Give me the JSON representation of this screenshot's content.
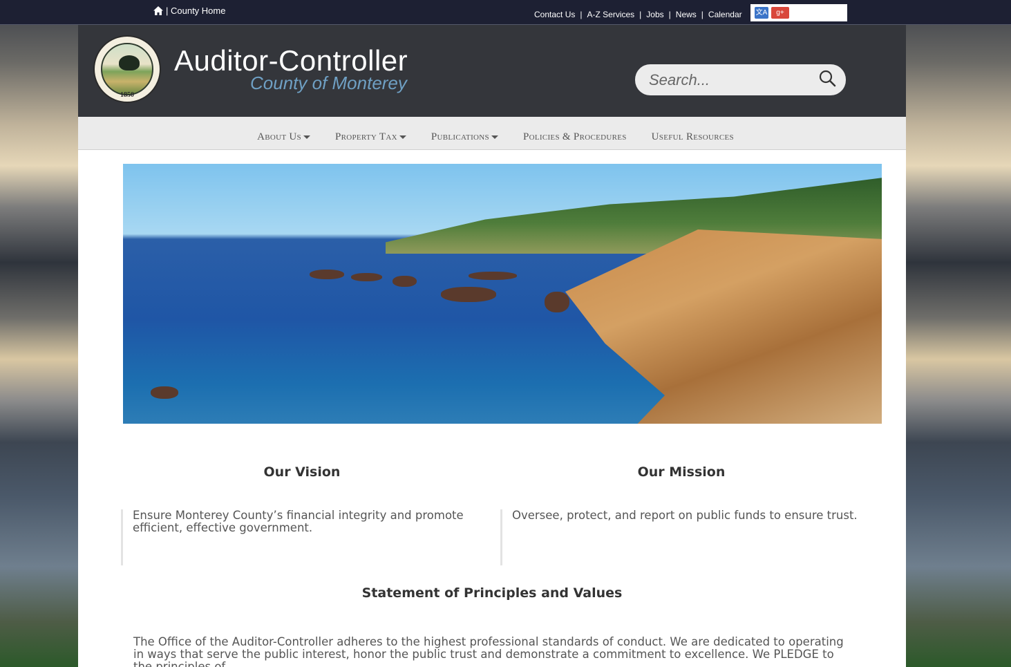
{
  "topbar": {
    "home_label": "| County Home",
    "links": [
      "Contact Us",
      "A-Z Services",
      "Jobs",
      "News",
      "Calendar"
    ],
    "separator": "|"
  },
  "header": {
    "title": "Auditor-Controller",
    "subtitle": "County of Monterey",
    "seal_text": "MONTEREY COUNTY CALIFORNIA",
    "seal_year": "1850",
    "search_placeholder": "Search..."
  },
  "nav": {
    "items": [
      {
        "label": "About Us",
        "dropdown": true
      },
      {
        "label": "Property Tax",
        "dropdown": true
      },
      {
        "label": "Publications",
        "dropdown": true
      },
      {
        "label": "Policies & Procedures",
        "dropdown": false
      },
      {
        "label": "Useful Resources",
        "dropdown": false
      }
    ]
  },
  "content": {
    "vision_title": "Our Vision",
    "vision_text": "Ensure Monterey County’s financial integrity and promote efficient, effective government.",
    "mission_title": "Our Mission",
    "mission_text": "Oversee, protect, and report on public funds to ensure trust.",
    "principles_title": "Statement of Principles and Values",
    "principles_text": "The Office of the Auditor-Controller adheres to the highest professional standards of conduct. We are dedicated to operating in ways that serve the public interest, honor the public trust and demonstrate a commitment to excellence. We PLEDGE to the principles of"
  },
  "colors": {
    "topbar": "#1d2033",
    "header": "#34363b",
    "subtitle": "#6fa0c4",
    "nav": "#ebebeb"
  }
}
